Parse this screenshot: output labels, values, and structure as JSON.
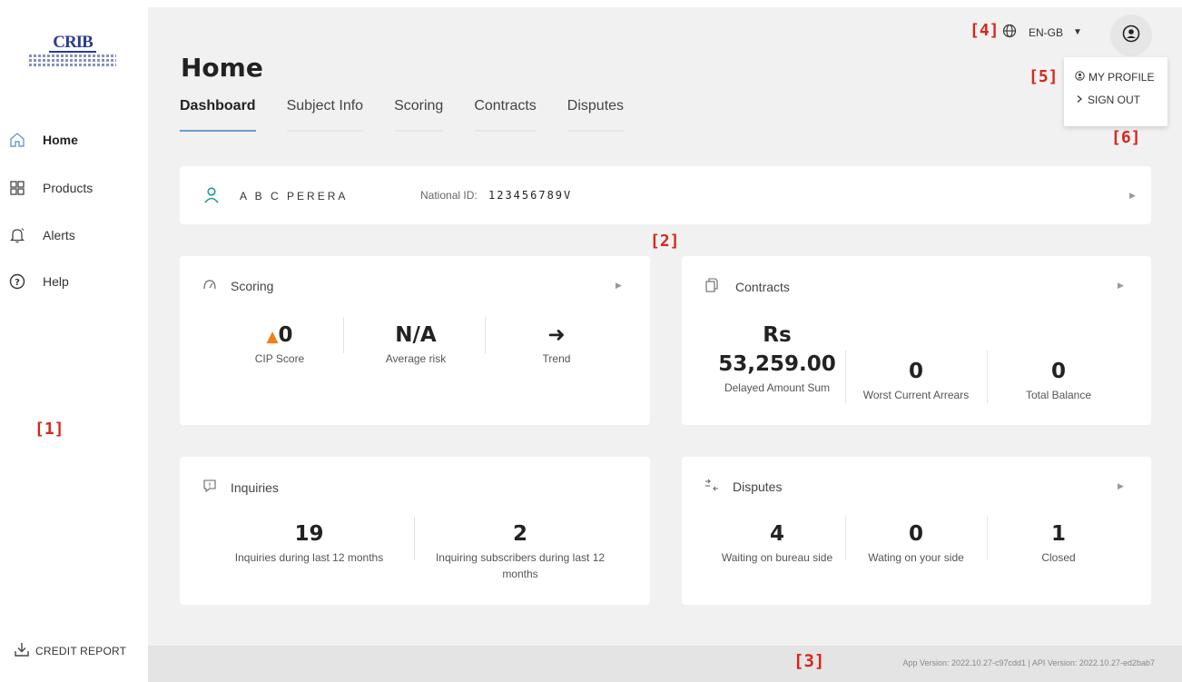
{
  "sidebar": {
    "items": [
      {
        "label": "Home",
        "icon": "home-icon"
      },
      {
        "label": "Products",
        "icon": "grid-icon"
      },
      {
        "label": "Alerts",
        "icon": "bell-icon"
      },
      {
        "label": "Help",
        "icon": "help-icon"
      }
    ],
    "credit_report_label": "CREDIT REPORT",
    "logo_text": "CRIB"
  },
  "markers": {
    "m1": "[1]",
    "m2": "[2]",
    "m3": "[3]",
    "m4": "[4]",
    "m5": "[5]",
    "m6": "[6]"
  },
  "header": {
    "title": "Home",
    "language": "EN-GB",
    "tabs": [
      "Dashboard",
      "Subject Info",
      "Scoring",
      "Contracts",
      "Disputes"
    ],
    "active_tab": "Dashboard"
  },
  "user_menu": {
    "items": [
      {
        "label": "MY PROFILE",
        "icon": "user-circle-icon"
      },
      {
        "label": "SIGN OUT",
        "icon": "chevron-right-icon"
      }
    ]
  },
  "subject": {
    "name": "A B C PERERA",
    "national_id_label": "National ID:",
    "national_id": "123456789V"
  },
  "scoring": {
    "title": "Scoring",
    "cip_score": "0",
    "cip_score_label": "CIP Score",
    "average_risk": "N/A",
    "average_risk_label": "Average risk",
    "trend_symbol": "➜",
    "trend_label": "Trend"
  },
  "contracts": {
    "title": "Contracts",
    "currency": "Rs",
    "delayed_amount": "53,259.00",
    "delayed_amount_label": "Delayed Amount Sum",
    "worst_arrears": "0",
    "worst_arrears_label": "Worst Current Arrears",
    "total_balance": "0",
    "total_balance_label": "Total Balance"
  },
  "inquiries": {
    "title": "Inquiries",
    "count": "19",
    "count_label": "Inquiries during last 12 months",
    "subscribers": "2",
    "subscribers_label": "Inquiring subscribers during last 12 months"
  },
  "disputes": {
    "title": "Disputes",
    "bureau": "4",
    "bureau_label": "Waiting on bureau side",
    "yours": "0",
    "yours_label": "Wating on your side",
    "closed": "1",
    "closed_label": "Closed"
  },
  "footer": {
    "version": "App Version: 2022.10.27-c97cdd1 | API Version: 2022.10.27-ed2bab7"
  },
  "colors": {
    "accent": "#6b9bc9",
    "warning": "#f07f1a",
    "marker": "#d9261c",
    "subject_icon": "#1aa08f"
  }
}
